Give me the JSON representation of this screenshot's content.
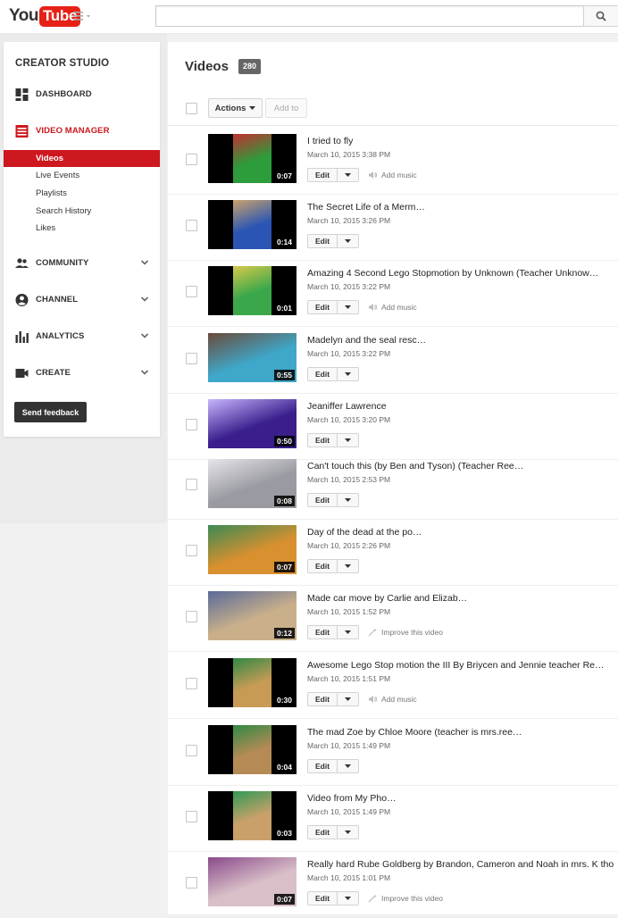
{
  "header": {
    "logo_you": "You",
    "logo_tube": "Tube",
    "search_placeholder": ""
  },
  "sidebar": {
    "title": "CREATOR STUDIO",
    "sections": [
      {
        "label": "DASHBOARD",
        "icon": "dashboard-icon"
      },
      {
        "label": "VIDEO MANAGER",
        "icon": "video-manager-icon",
        "accent": "#cc181e"
      },
      {
        "label": "COMMUNITY",
        "icon": "community-icon"
      },
      {
        "label": "CHANNEL",
        "icon": "channel-icon"
      },
      {
        "label": "ANALYTICS",
        "icon": "analytics-icon"
      },
      {
        "label": "CREATE",
        "icon": "create-icon"
      }
    ],
    "sub_items": [
      "Videos",
      "Live Events",
      "Playlists",
      "Search History",
      "Likes"
    ],
    "feedback_label": "Send feedback"
  },
  "main": {
    "heading": "Videos",
    "count": "280",
    "actions_label": "Actions",
    "add_to_label": "Add to",
    "edit_label": "Edit",
    "videos": [
      {
        "title": "I tried to fly",
        "date": "March 10, 2015 3:38 PM",
        "duration": "0:07",
        "extra": "Add music",
        "extra_icon": "speaker-icon",
        "thumb": [
          "#2d9c3a",
          "#c03030"
        ],
        "wide": false
      },
      {
        "title": "The Secret Life of a Merm…",
        "date": "March 10, 2015 3:26 PM",
        "duration": "0:14",
        "extra": "",
        "extra_icon": "",
        "thumb": [
          "#2a55b5",
          "#c9a36a"
        ],
        "wide": false
      },
      {
        "title": "Amazing 4 Second Lego Stopmotion by Unknown (Teacher Unknow…",
        "date": "March 10, 2015 3:22 PM",
        "duration": "0:01",
        "extra": "Add music",
        "extra_icon": "speaker-icon",
        "thumb": [
          "#3aa84a",
          "#d7c84a"
        ],
        "wide": false
      },
      {
        "title": "Madelyn and the seal resc…",
        "date": "March 10, 2015 3:22 PM",
        "duration": "0:55",
        "extra": "",
        "extra_icon": "",
        "thumb": [
          "#3fa7c9",
          "#6b4a3a"
        ],
        "wide": true
      },
      {
        "title": "Jeaniffer Lawrence",
        "date": "March 10, 2015 3:20 PM",
        "duration": "0:50",
        "extra": "",
        "extra_icon": "",
        "thumb": [
          "#3a1f8c",
          "#c8b6ff"
        ],
        "wide": true
      },
      {
        "title": "Can't touch this (by Ben and Tyson) (Teacher Ree…",
        "date": "March 10, 2015 2:53 PM",
        "duration": "0:08",
        "extra": "",
        "extra_icon": "",
        "thumb": [
          "#9a9aa2",
          "#e6e6ea"
        ],
        "wide": true
      },
      {
        "title": "Day of the dead at the po…",
        "date": "March 10, 2015 2:26 PM",
        "duration": "0:07",
        "extra": "",
        "extra_icon": "",
        "thumb": [
          "#d9902f",
          "#3a8a55"
        ],
        "wide": true
      },
      {
        "title": "Made car move by Carlie and Elizab…",
        "date": "March 10, 2015 1:52 PM",
        "duration": "0:12",
        "extra": "Improve this video",
        "extra_icon": "magic-wand-icon",
        "thumb": [
          "#c9b08a",
          "#5a6a9a"
        ],
        "wide": true
      },
      {
        "title": "Awesome Lego Stop motion the III By Briycen and Jennie teacher Re…",
        "date": "March 10, 2015 1:51 PM",
        "duration": "0:30",
        "extra": "Add music",
        "extra_icon": "speaker-icon",
        "thumb": [
          "#c79a55",
          "#2f8a44"
        ],
        "wide": false
      },
      {
        "title": "The mad Zoe by Chloe Moore (teacher is mrs.ree…",
        "date": "March 10, 2015 1:49 PM",
        "duration": "0:04",
        "extra": "",
        "extra_icon": "",
        "thumb": [
          "#b58a55",
          "#2f8a44"
        ],
        "wide": false
      },
      {
        "title": "Video from My Pho…",
        "date": "March 10, 2015 1:49 PM",
        "duration": "0:03",
        "extra": "",
        "extra_icon": "",
        "thumb": [
          "#c9a06a",
          "#2f9a54"
        ],
        "wide": false
      },
      {
        "title": "Really hard Rube Goldberg by Brandon, Cameron and Noah in mrs. K tho",
        "date": "March 10, 2015 1:01 PM",
        "duration": "0:07",
        "extra": "Improve this video",
        "extra_icon": "magic-wand-icon",
        "thumb": [
          "#d9c0c8",
          "#8a4a8a"
        ],
        "wide": true
      }
    ]
  }
}
